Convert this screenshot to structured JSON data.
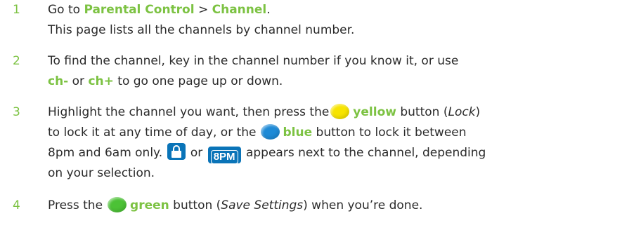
{
  "colors": {
    "accent_green": "#7cc242",
    "text": "#2b2b2b",
    "yellow_button": "#f7e400",
    "blue_button": "#1e8ad6",
    "green_button": "#4cc236",
    "badge_blue": "#0a74b8"
  },
  "steps": [
    {
      "number": "1",
      "lines": [
        {
          "t0": "Go to ",
          "b0": "Parental Control",
          "t1": " > ",
          "b1": "Channel",
          "t2": "."
        },
        {
          "t0": "This page lists all the channels by channel number."
        }
      ]
    },
    {
      "number": "2",
      "lines": [
        {
          "t0": "To find the channel, key in the channel number if you know it, or use"
        },
        {
          "b0": "ch-",
          "t0": " or ",
          "b1": "ch+",
          "t1": " to go one page up or down."
        }
      ]
    },
    {
      "number": "3",
      "lines": [
        {
          "t0": "Highlight the channel you want, then press the",
          "icon0": "yellow-button-icon",
          "b0": "yellow",
          "t1": " button (",
          "i0": "Lock",
          "t2": ")"
        },
        {
          "t0": "to lock it at any time of day, or the",
          "icon0": "blue-button-icon",
          "b0": "blue",
          "t1": " button to lock it between"
        },
        {
          "t0": "8pm and 6am only.",
          "icon0": "lock-icon",
          "t1": " or ",
          "badge": "8PM",
          "t2": " appears next to the channel, depending"
        },
        {
          "t0": "on your selection."
        }
      ]
    },
    {
      "number": "4",
      "lines": [
        {
          "t0": "Press the",
          "icon0": "green-button-icon",
          "b0": "green",
          "t1": " button (",
          "i0": "Save Settings",
          "t2": ") when you’re done."
        }
      ]
    }
  ]
}
